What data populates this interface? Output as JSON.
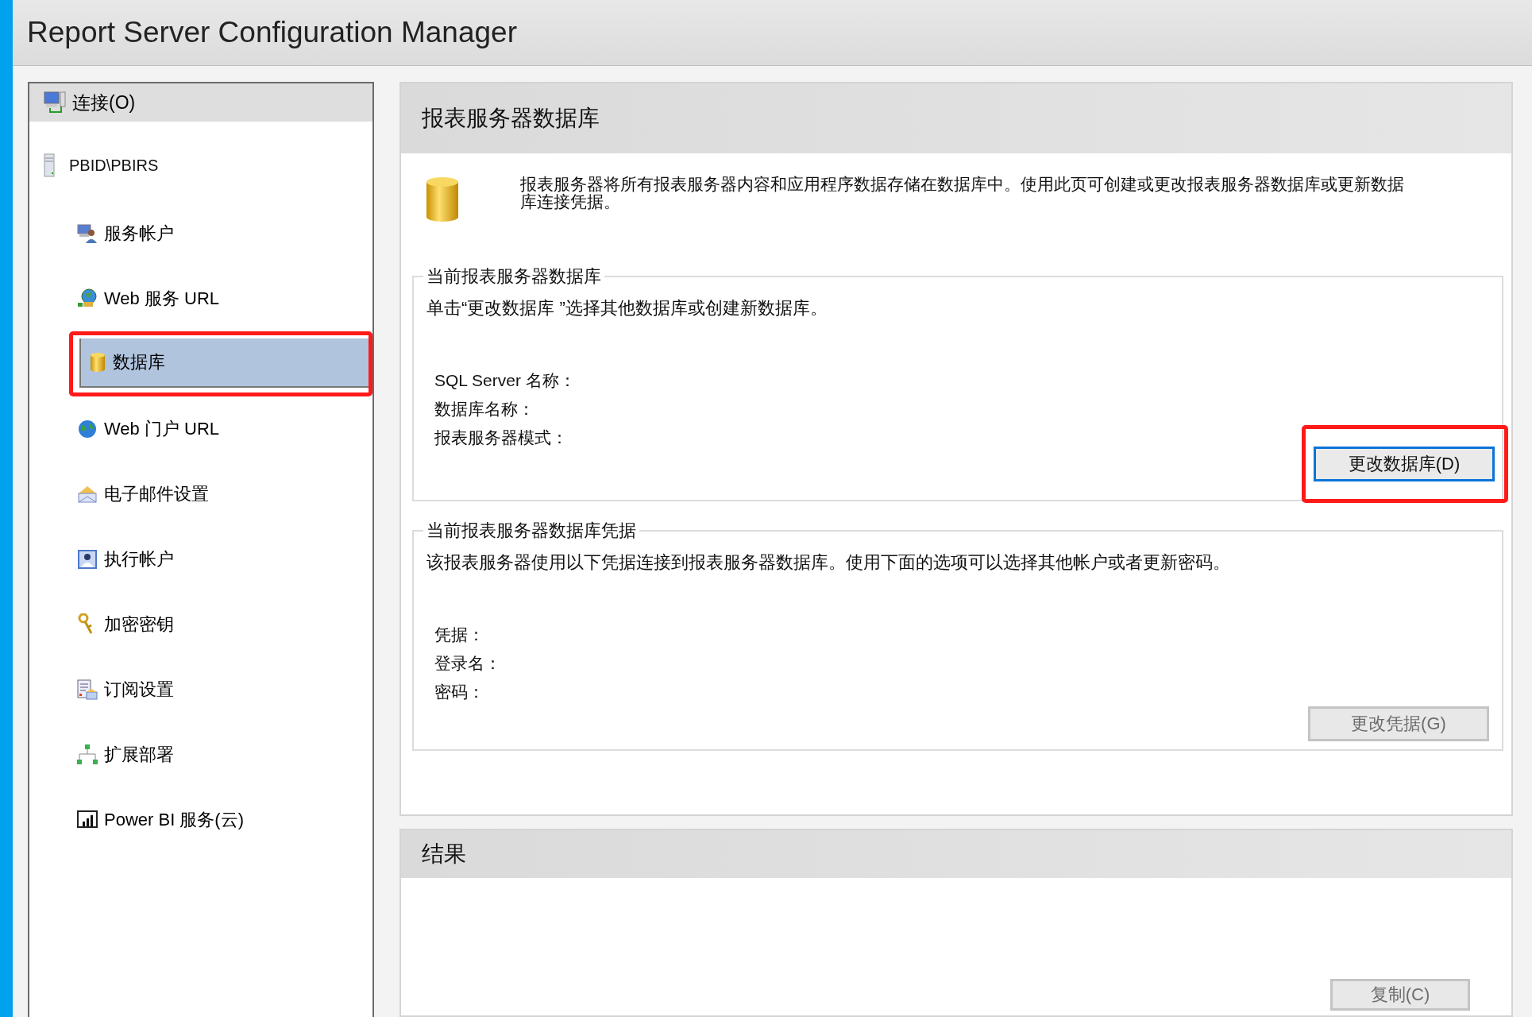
{
  "window": {
    "title": "Report Server Configuration Manager"
  },
  "sidebar": {
    "connect": {
      "label": "连接(O)"
    },
    "server": {
      "label": "PBID\\PBIRS"
    },
    "items": [
      {
        "label": "服务帐户",
        "kind": "account",
        "selected": false,
        "highlighted": false
      },
      {
        "label": "Web 服务 URL",
        "kind": "webservice",
        "selected": false,
        "highlighted": false
      },
      {
        "label": "数据库",
        "kind": "database",
        "selected": true,
        "highlighted": true
      },
      {
        "label": "Web 门户 URL",
        "kind": "globe",
        "selected": false,
        "highlighted": false
      },
      {
        "label": "电子邮件设置",
        "kind": "mail",
        "selected": false,
        "highlighted": false
      },
      {
        "label": "执行帐户",
        "kind": "user",
        "selected": false,
        "highlighted": false
      },
      {
        "label": "加密密钥",
        "kind": "keys",
        "selected": false,
        "highlighted": false
      },
      {
        "label": "订阅设置",
        "kind": "subscription",
        "selected": false,
        "highlighted": false
      },
      {
        "label": "扩展部署",
        "kind": "network",
        "selected": false,
        "highlighted": false
      },
      {
        "label": "Power BI 服务(云)",
        "kind": "chart",
        "selected": false,
        "highlighted": false
      }
    ]
  },
  "main": {
    "title": "报表服务器数据库",
    "intro": "报表服务器将所有报表服务器内容和应用程序数据存储在数据库中。使用此页可创建或更改报表服务器数据库或更新数据库连接凭据。",
    "groups": [
      {
        "legend": "当前报表服务器数据库",
        "hint": "单击“更改数据库 ”选择其他数据库或创建新数据库。",
        "fields": [
          "SQL Server 名称：",
          "数据库名称：",
          "报表服务器模式："
        ],
        "button": {
          "label": "更改数据库(D)",
          "disabled": false,
          "focused": true,
          "highlighted": true
        }
      },
      {
        "legend": "当前报表服务器数据库凭据",
        "hint": "该报表服务器使用以下凭据连接到报表服务器数据库。使用下面的选项可以选择其他帐户或者更新密码。",
        "fields": [
          "凭据：",
          "登录名：",
          "密码："
        ],
        "button": {
          "label": "更改凭据(G)",
          "disabled": true,
          "focused": false
        }
      }
    ]
  },
  "results": {
    "title": "结果",
    "button": {
      "label": "复制(C)",
      "disabled": true,
      "focused": false
    }
  }
}
